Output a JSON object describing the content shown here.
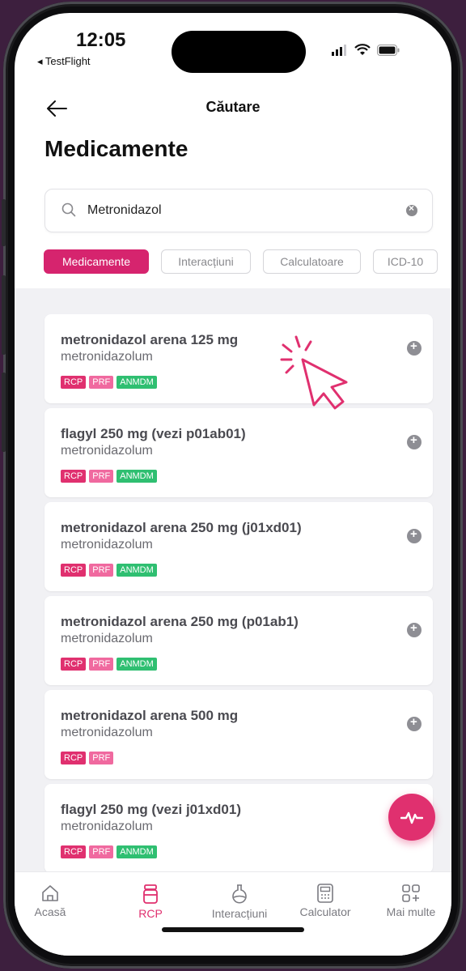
{
  "status_bar": {
    "time": "12:05",
    "back_app": "◂ TestFlight"
  },
  "nav": {
    "title": "Căutare"
  },
  "page": {
    "title": "Medicamente"
  },
  "search": {
    "value": "Metronidazol",
    "placeholder": ""
  },
  "tabs": [
    {
      "label": "Medicamente",
      "active": true
    },
    {
      "label": "Interacțiuni",
      "active": false
    },
    {
      "label": "Calculatoare",
      "active": false
    },
    {
      "label": "ICD-10",
      "active": false
    }
  ],
  "results": [
    {
      "title": "metronidazol arena 125 mg",
      "subtitle": "metronidazolum",
      "badges": [
        "RCP",
        "PRF",
        "ANMDM"
      ]
    },
    {
      "title": "flagyl 250 mg (vezi p01ab01)",
      "subtitle": "metronidazolum",
      "badges": [
        "RCP",
        "PRF",
        "ANMDM"
      ]
    },
    {
      "title": "metronidazol arena 250 mg (j01xd01)",
      "subtitle": "metronidazolum",
      "badges": [
        "RCP",
        "PRF",
        "ANMDM"
      ]
    },
    {
      "title": "metronidazol arena 250 mg (p01ab1)",
      "subtitle": "metronidazolum",
      "badges": [
        "RCP",
        "PRF",
        "ANMDM"
      ]
    },
    {
      "title": "metronidazol  arena 500 mg",
      "subtitle": "metronidazolum",
      "badges": [
        "RCP",
        "PRF"
      ]
    },
    {
      "title": "flagyl 250 mg (vezi j01xd01)",
      "subtitle": "metronidazolum",
      "badges": [
        "RCP",
        "PRF",
        "ANMDM"
      ]
    }
  ],
  "tabbar": {
    "items": [
      {
        "label": "Acasă",
        "icon": "home-icon",
        "active": false
      },
      {
        "label": "RCP",
        "icon": "pill-bottle-icon",
        "active": true
      },
      {
        "label": "Interacțiuni",
        "icon": "flask-icon",
        "active": false
      },
      {
        "label": "Calculator",
        "icon": "calculator-icon",
        "active": false
      },
      {
        "label": "Mai multe",
        "icon": "grid-plus-icon",
        "active": false
      }
    ]
  },
  "colors": {
    "accent": "#e0306f",
    "badge_rcp": "#e0306f",
    "badge_prf": "#f0699f",
    "badge_anmdm": "#2fbf71",
    "frame_bg": "#3d1f3e"
  }
}
